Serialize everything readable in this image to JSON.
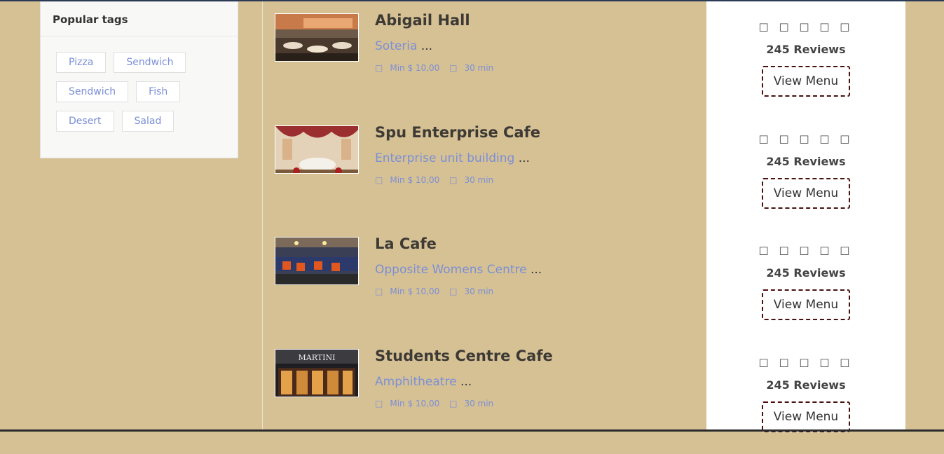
{
  "sidebar": {
    "popular_tags": {
      "title": "Popular tags",
      "tags": [
        "Pizza",
        "Sendwich",
        "Sendwich",
        "Fish",
        "Desert",
        "Salad"
      ]
    }
  },
  "restaurants": [
    {
      "name": "Abigail Hall",
      "address": "Soteria",
      "ellipsis": "...",
      "min_order": "Min $ 10,00",
      "delivery_time": "30 min",
      "rating_icons": "□ □ □ □ □",
      "reviews": "245 Reviews",
      "view_menu": "View Menu"
    },
    {
      "name": "Spu Enterprise Cafe",
      "address": "Enterprise unit building",
      "ellipsis": "...",
      "min_order": "Min $ 10,00",
      "delivery_time": "30 min",
      "rating_icons": "□ □ □ □ □",
      "reviews": "245 Reviews",
      "view_menu": "View Menu"
    },
    {
      "name": "La Cafe",
      "address": "Opposite Womens Centre",
      "ellipsis": "...",
      "min_order": "Min $ 10,00",
      "delivery_time": "30 min",
      "rating_icons": "□ □ □ □ □",
      "reviews": "245 Reviews",
      "view_menu": "View Menu"
    },
    {
      "name": "Students Centre Cafe",
      "address": "Amphitheatre",
      "ellipsis": "...",
      "min_order": "Min $ 10,00",
      "delivery_time": "30 min",
      "rating_icons": "□ □ □ □ □",
      "reviews": "245 Reviews",
      "view_menu": "View Menu"
    }
  ],
  "signage": {
    "martini": "MARTINI"
  },
  "colors": {
    "page_bg": "#d6c195",
    "link": "#7b8fd6",
    "button_border": "#4a1010",
    "card_bg": "#ffffff"
  }
}
